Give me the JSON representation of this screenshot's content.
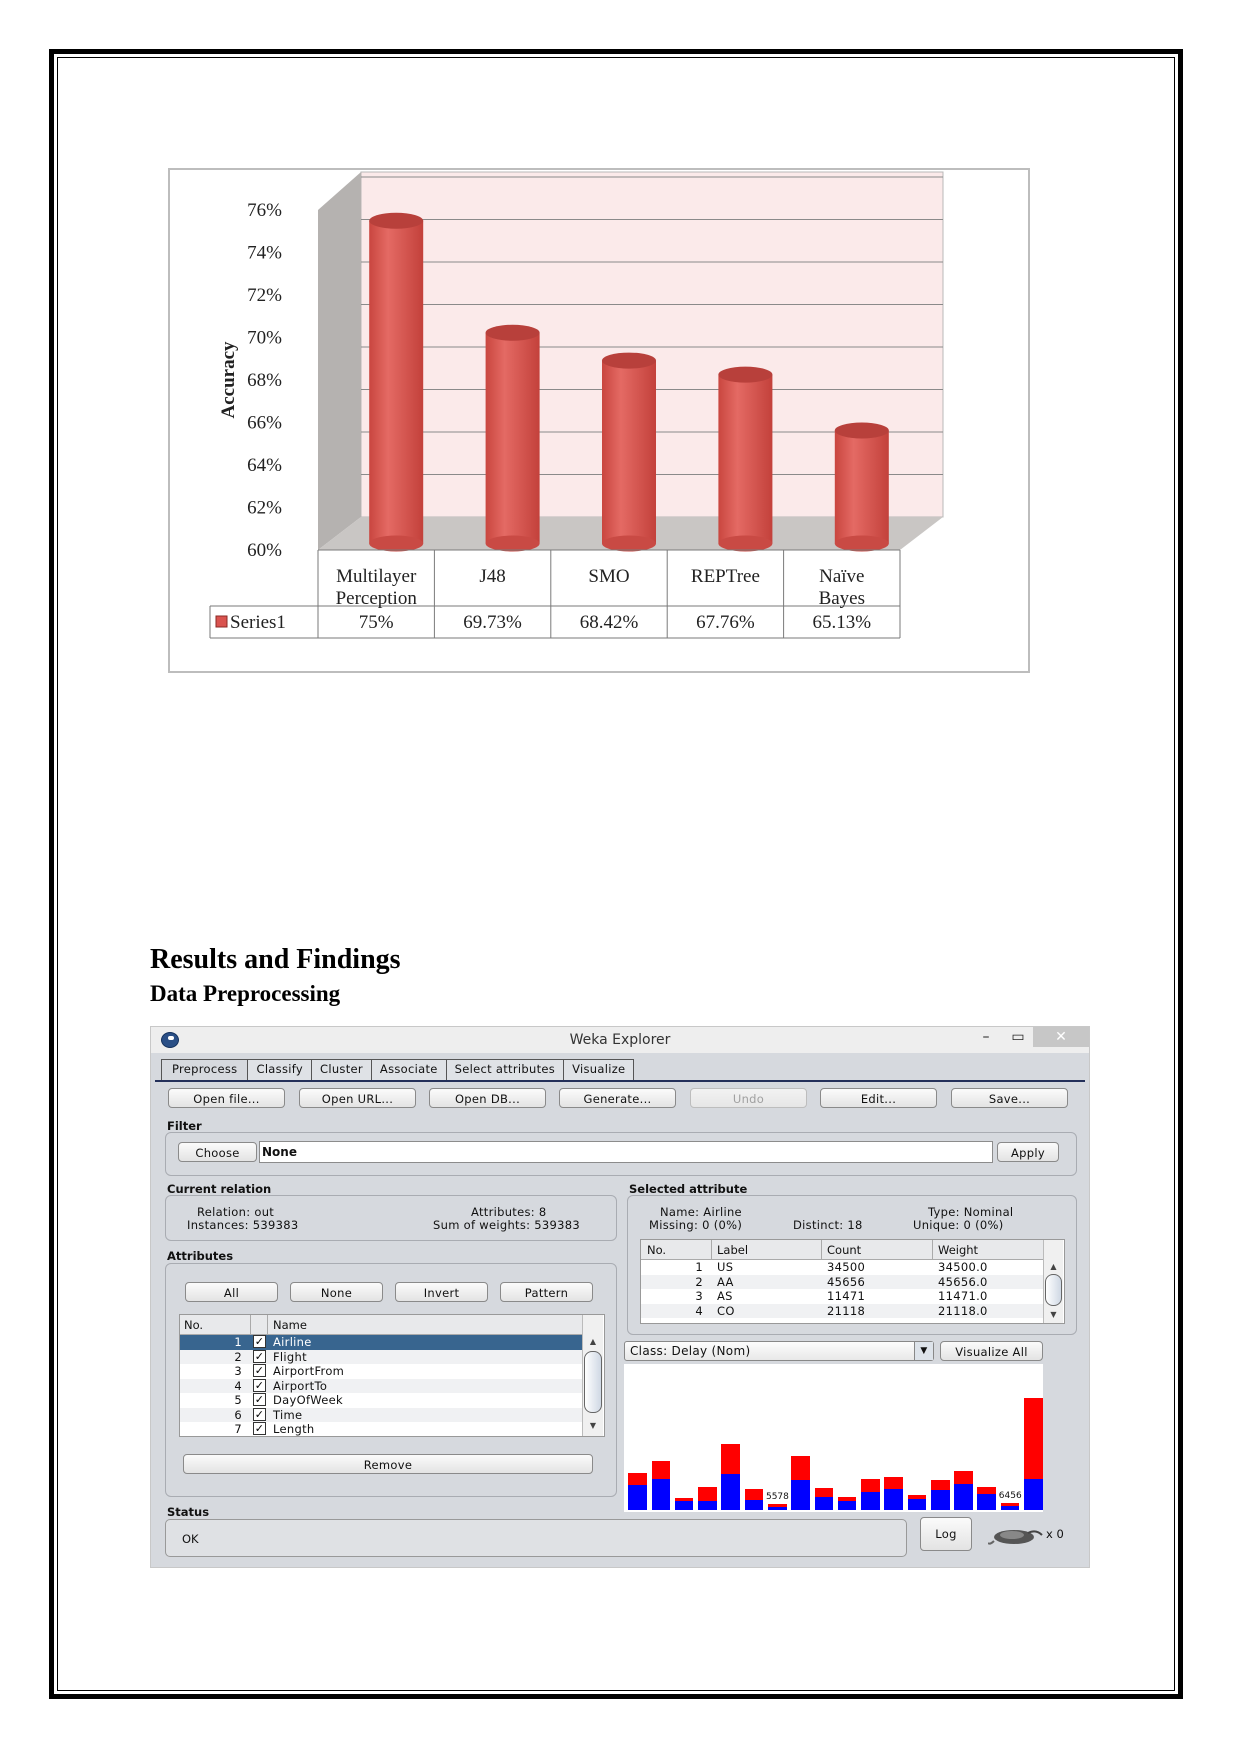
{
  "document": {
    "heading": "Results and Findings",
    "subheading": "Data Preprocessing"
  },
  "chart_data": {
    "type": "bar",
    "style": "3d-cylinder",
    "title": "",
    "xlabel": "",
    "ylabel": "Accuracy",
    "ylim": [
      0.6,
      0.76
    ],
    "yticks": [
      "60%",
      "62%",
      "64%",
      "66%",
      "68%",
      "70%",
      "72%",
      "74%",
      "76%"
    ],
    "ytick_values": [
      60,
      62,
      64,
      66,
      68,
      70,
      72,
      74,
      76
    ],
    "grid": true,
    "categories": [
      "Multilayer Perception",
      "J48",
      "SMO",
      "REPTree",
      "Naïve Bayes"
    ],
    "category_lines": [
      [
        "Multilayer",
        "Perception"
      ],
      [
        "J48"
      ],
      [
        "SMO"
      ],
      [
        "REPTree"
      ],
      [
        "Naïve",
        "Bayes"
      ]
    ],
    "series": [
      {
        "name": "Series1",
        "color": "#d9534f",
        "values": [
          75,
          69.73,
          68.42,
          67.76,
          65.13
        ],
        "labels": [
          "75%",
          "69.73%",
          "68.42%",
          "67.76%",
          "65.13%"
        ]
      }
    ],
    "legend": "data-table"
  },
  "weka": {
    "window_title": "Weka Explorer",
    "window_controls": {
      "minimize": "–",
      "maximize": "▭",
      "close": "✕"
    },
    "tabs": [
      {
        "label": "Preprocess",
        "active": true
      },
      {
        "label": "Classify",
        "active": false
      },
      {
        "label": "Cluster",
        "active": false
      },
      {
        "label": "Associate",
        "active": false
      },
      {
        "label": "Select attributes",
        "active": false
      },
      {
        "label": "Visualize",
        "active": false
      }
    ],
    "toolbar": {
      "open_file": "Open file...",
      "open_url": "Open URL...",
      "open_db": "Open DB...",
      "generate": "Generate...",
      "undo": "Undo",
      "edit": "Edit...",
      "save": "Save..."
    },
    "filter": {
      "section": "Filter",
      "choose": "Choose",
      "value": "None",
      "apply": "Apply"
    },
    "current_relation": {
      "section": "Current relation",
      "relation_label": "Relation:",
      "relation_value": "out",
      "instances_label": "Instances:",
      "instances_value": "539383",
      "attributes_label": "Attributes:",
      "attributes_value": "8",
      "sum_weights_label": "Sum of weights:",
      "sum_weights_value": "539383"
    },
    "attributes": {
      "section": "Attributes",
      "btn_all": "All",
      "btn_none": "None",
      "btn_invert": "Invert",
      "btn_pattern": "Pattern",
      "col_no": "No.",
      "col_name": "Name",
      "rows": [
        {
          "no": "1",
          "name": "Airline",
          "checked": true,
          "selected": true
        },
        {
          "no": "2",
          "name": "Flight",
          "checked": true,
          "selected": false
        },
        {
          "no": "3",
          "name": "AirportFrom",
          "checked": true,
          "selected": false
        },
        {
          "no": "4",
          "name": "AirportTo",
          "checked": true,
          "selected": false
        },
        {
          "no": "5",
          "name": "DayOfWeek",
          "checked": true,
          "selected": false
        },
        {
          "no": "6",
          "name": "Time",
          "checked": true,
          "selected": false
        },
        {
          "no": "7",
          "name": "Length",
          "checked": true,
          "selected": false
        }
      ],
      "remove": "Remove"
    },
    "selected_attribute": {
      "section": "Selected attribute",
      "name_label": "Name:",
      "name_value": "Airline",
      "type_label": "Type:",
      "type_value": "Nominal",
      "missing_label": "Missing:",
      "missing_value": "0 (0%)",
      "distinct_label": "Distinct:",
      "distinct_value": "18",
      "unique_label": "Unique:",
      "unique_value": "0 (0%)",
      "col_no": "No.",
      "col_label": "Label",
      "col_count": "Count",
      "col_weight": "Weight",
      "rows": [
        {
          "no": "1",
          "label": "US",
          "count": "34500",
          "weight": "34500.0"
        },
        {
          "no": "2",
          "label": "AA",
          "count": "45656",
          "weight": "45656.0"
        },
        {
          "no": "3",
          "label": "AS",
          "count": "11471",
          "weight": "11471.0"
        },
        {
          "no": "4",
          "label": "CO",
          "count": "21118",
          "weight": "21118.0"
        }
      ]
    },
    "class_selector": "Class: Delay (Nom)",
    "visualize_all": "Visualize All",
    "histogram": {
      "colors": {
        "class_a": "#0000ff",
        "class_b": "#ff0000"
      },
      "relative_total": [
        36,
        48,
        12,
        22,
        64,
        20,
        6,
        53,
        21,
        13,
        30,
        32,
        15,
        29,
        38,
        22,
        7,
        109
      ],
      "relative_blue": [
        24,
        30,
        9,
        9,
        35,
        10,
        3,
        29,
        13,
        9,
        18,
        20,
        11,
        19,
        25,
        16,
        4,
        30
      ],
      "bar_labels": {
        "6": "5578",
        "16": "6456"
      }
    },
    "status": {
      "section": "Status",
      "text": "OK",
      "log": "Log",
      "task_count": "x 0"
    }
  }
}
